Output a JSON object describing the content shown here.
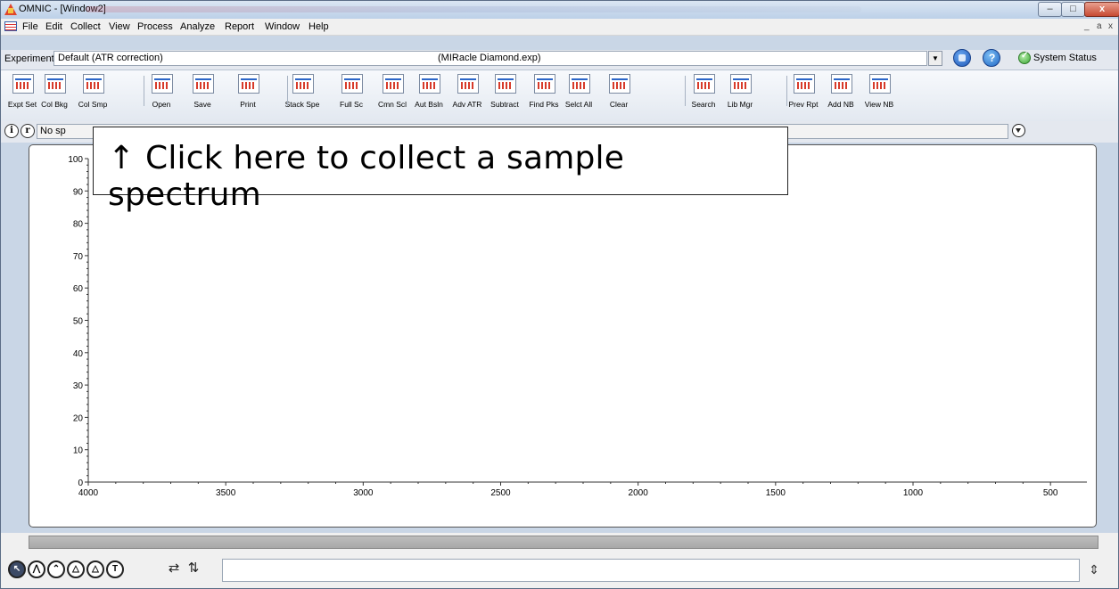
{
  "window": {
    "title": "OMNIC - [Window2]",
    "minimize": "–",
    "maximize": "□",
    "close": "x"
  },
  "menu": {
    "items": [
      "File",
      "Edit",
      "Collect",
      "View",
      "Process",
      "Analyze",
      "Report",
      "Window",
      "Help"
    ],
    "mdi": [
      "_",
      "a",
      "x"
    ]
  },
  "experiment": {
    "label": "Experiment:",
    "value": "Default (ATR correction)",
    "file": "(MIRacle Diamond.exp)",
    "status": "System Status"
  },
  "toolbar": {
    "buttons": [
      {
        "label": "Expt Set",
        "icon": "experiment-setup-icon"
      },
      {
        "label": "Col Bkg",
        "icon": "collect-background-icon"
      },
      {
        "label": "Col Smp",
        "icon": "collect-sample-icon"
      },
      {
        "label": "Open",
        "icon": "open-folder-icon"
      },
      {
        "label": "Save",
        "icon": "save-disk-icon"
      },
      {
        "label": "Print",
        "icon": "printer-icon"
      },
      {
        "label": "Stack Spe",
        "icon": "stack-spectra-icon"
      },
      {
        "label": "Full Sc",
        "icon": "full-scale-icon"
      },
      {
        "label": "Cmn Scl",
        "icon": "common-scale-icon"
      },
      {
        "label": "Aut Bsln",
        "icon": "auto-baseline-icon"
      },
      {
        "label": "Adv ATR",
        "icon": "advanced-atr-icon"
      },
      {
        "label": "Subtract",
        "icon": "subtract-icon"
      },
      {
        "label": "Find Pks",
        "icon": "find-peaks-icon"
      },
      {
        "label": "Selct All",
        "icon": "select-all-icon"
      },
      {
        "label": "Clear",
        "icon": "clear-icon"
      },
      {
        "label": "Search",
        "icon": "search-icon"
      },
      {
        "label": "Lib Mgr",
        "icon": "library-manager-icon"
      },
      {
        "label": "Prev Rpt",
        "icon": "preview-report-icon"
      },
      {
        "label": "Add NB",
        "icon": "add-notebook-icon"
      },
      {
        "label": "View NB",
        "icon": "view-notebook-icon"
      }
    ]
  },
  "info_bar": {
    "text": "No sp",
    "info_glyph": "i",
    "ref_glyph": "r"
  },
  "callout": {
    "text": "↑ Click here to collect a sample spectrum"
  },
  "chart_data": {
    "type": "line",
    "series": [],
    "xlim": [
      4000,
      400
    ],
    "ylim": [
      0,
      100
    ],
    "x_ticks": [
      "4000",
      "3500",
      "3000",
      "2500",
      "2000",
      "1500",
      "1000",
      "500"
    ],
    "y_ticks": [
      "100",
      "90",
      "80",
      "70",
      "60",
      "50",
      "40",
      "30",
      "20",
      "10",
      "0"
    ],
    "grid": false
  },
  "bottom_tools": [
    {
      "icon": "selection-tool-icon",
      "glyph": "↖"
    },
    {
      "icon": "region-tool-icon",
      "glyph": "⋀"
    },
    {
      "icon": "peak-height-tool-icon",
      "glyph": "⌃"
    },
    {
      "icon": "peak-area-tool-icon",
      "glyph": "△"
    },
    {
      "icon": "corrected-area-tool-icon",
      "glyph": "△"
    },
    {
      "icon": "text-tool-icon",
      "glyph": "T"
    }
  ],
  "bottom_extra": [
    {
      "icon": "horizontal-expand-icon",
      "glyph": "⇄"
    },
    {
      "icon": "vertical-expand-icon",
      "glyph": "⇅"
    }
  ],
  "command_scroll": "⇕"
}
